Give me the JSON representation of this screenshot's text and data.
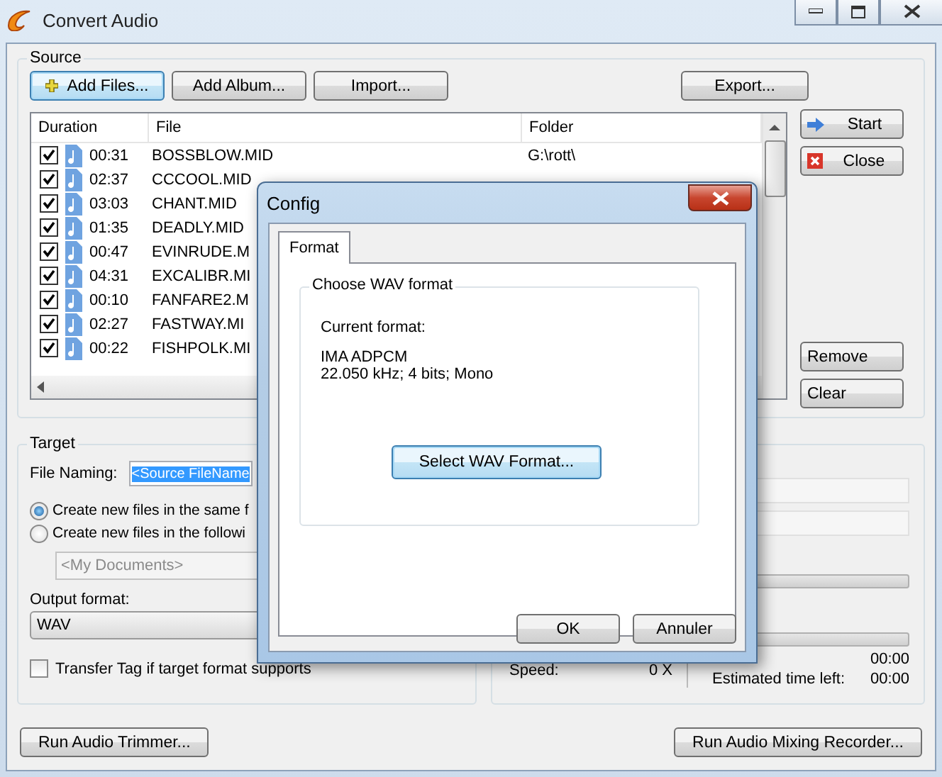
{
  "window": {
    "title": "Convert Audio"
  },
  "source": {
    "title": "Source",
    "buttons": [
      {
        "label": "Add Files...",
        "kind": "add",
        "focused": true
      },
      {
        "label": "Add Album...",
        "kind": "plain",
        "focused": false
      },
      {
        "label": "Import...",
        "kind": "plain",
        "focused": false
      }
    ],
    "export_button": "Export...",
    "columns": [
      "Duration",
      "File",
      "Folder"
    ],
    "rows": [
      {
        "checked": true,
        "duration": "00:31",
        "file": "BOSSBLOW.MID",
        "folder": "G:\\rott\\"
      },
      {
        "checked": true,
        "duration": "02:37",
        "file": "CCCOOL.MID"
      },
      {
        "checked": true,
        "duration": "03:03",
        "file": "CHANT.MID"
      },
      {
        "checked": true,
        "duration": "01:35",
        "file": "DEADLY.MID"
      },
      {
        "checked": true,
        "duration": "00:47",
        "file": "EVINRUDE.M"
      },
      {
        "checked": true,
        "duration": "04:31",
        "file": "EXCALIBR.MI"
      },
      {
        "checked": true,
        "duration": "00:10",
        "file": "FANFARE2.M"
      },
      {
        "checked": true,
        "duration": "02:27",
        "file": "FASTWAY.MI"
      },
      {
        "checked": true,
        "duration": "00:22",
        "file": "FISHPOLK.MI"
      }
    ],
    "side_buttons": [
      {
        "label": "Start",
        "kind": "start"
      },
      {
        "label": "Close",
        "kind": "close"
      },
      {
        "label": "Remove",
        "kind": "plain"
      },
      {
        "label": "Clear",
        "kind": "plain"
      }
    ]
  },
  "target": {
    "title": "Target",
    "file_naming": {
      "label": "File Naming:",
      "value": "<Source FileName"
    },
    "locations": [
      {
        "label": "Create new files in the same f",
        "selected": true
      },
      {
        "label": "Create new files in the followi",
        "selected": false
      }
    ],
    "folder_field": {
      "value": "<My Documents>",
      "disabled": true
    },
    "output_format": {
      "label": "Output format:",
      "value": "WAV"
    },
    "transfer_tag": {
      "label": "Transfer Tag if target format supports",
      "checked": false
    }
  },
  "status": {
    "progress_bars": [
      {
        "level": 0
      },
      {
        "level": 0
      }
    ],
    "elapsed_time_value": "00:00",
    "speed": {
      "label": "Speed:",
      "value": "0 X"
    },
    "estimated_time_left": {
      "label": "Estimated time left:",
      "value": "00:00"
    }
  },
  "footer_buttons": [
    "Run Audio Trimmer...",
    "Run Audio Mixing Recorder..."
  ],
  "dialog": {
    "title": "Config",
    "tabs": [
      {
        "label": "Format",
        "selected": true
      }
    ],
    "group": "Choose WAV format",
    "current_format_label": "Current format:",
    "format_lines": [
      "IMA ADPCM",
      "22.050 kHz; 4 bits; Mono"
    ],
    "select_button": {
      "label": "Select WAV Format...",
      "focused": true
    },
    "buttons": [
      "OK",
      "Annuler"
    ]
  }
}
